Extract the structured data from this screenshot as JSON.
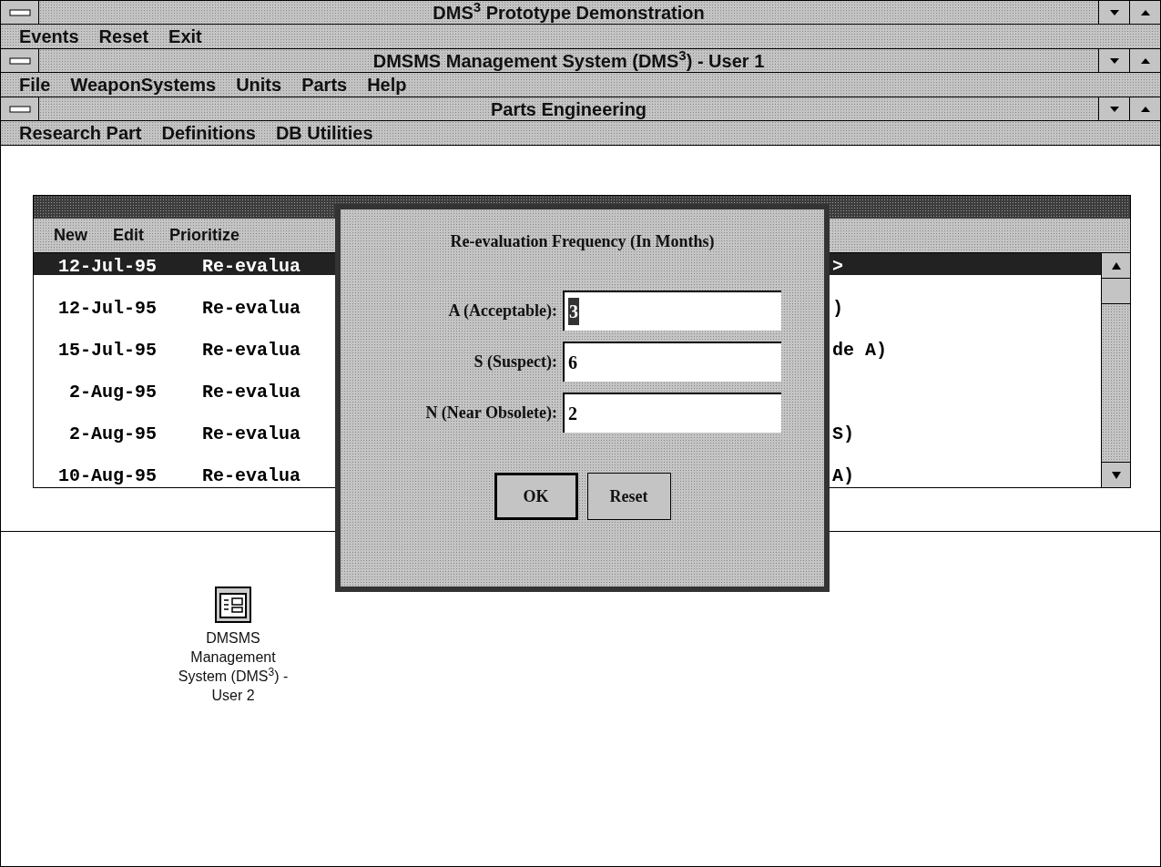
{
  "windows": [
    {
      "title": "DMS$^{3}$ Prototype Demonstration",
      "menu": [
        "Events",
        "Reset",
        "Exit"
      ]
    },
    {
      "title": "DMSMS Management System (DMS$^{3}$) - User 1",
      "menu": [
        "File",
        "WeaponSystems",
        "Units",
        "Parts",
        "Help"
      ]
    },
    {
      "title": "Parts Engineering",
      "menu": [
        "Research Part",
        "Definitions",
        "DB Utilities"
      ]
    }
  ],
  "list_window": {
    "menu": [
      "New",
      "Edit",
      "Prioritize"
    ],
    "rows": [
      {
        "date": "12-Jul-95",
        "text_left": "Re-evalua",
        "text_right": ">",
        "selected": true
      },
      {
        "date": "12-Jul-95",
        "text_left": "Re-evalua",
        "text_right": ")",
        "selected": false
      },
      {
        "date": "15-Jul-95",
        "text_left": "Re-evalua",
        "text_right": "de A)",
        "selected": false
      },
      {
        "date": "2-Aug-95",
        "text_left": "Re-evalua",
        "text_right": "",
        "selected": false
      },
      {
        "date": "2-Aug-95",
        "text_left": "Re-evalua",
        "text_right": "S)",
        "selected": false
      },
      {
        "date": "10-Aug-95",
        "text_left": "Re-evalua",
        "text_right": "A)",
        "selected": false
      }
    ]
  },
  "dialog": {
    "title": "Re-evaluation Frequency (In Months)",
    "fields": [
      {
        "label": "A (Acceptable):",
        "value": "3",
        "selected": true
      },
      {
        "label": "S (Suspect):",
        "value": "6",
        "selected": false
      },
      {
        "label": "N (Near Obsolete):",
        "value": "2",
        "selected": false
      }
    ],
    "buttons": [
      {
        "label": "OK",
        "default": true
      },
      {
        "label": "Reset",
        "default": false
      }
    ]
  },
  "desktop_icon": {
    "label": "DMSMS Management System (DMS$^{3}$) - User 2"
  }
}
